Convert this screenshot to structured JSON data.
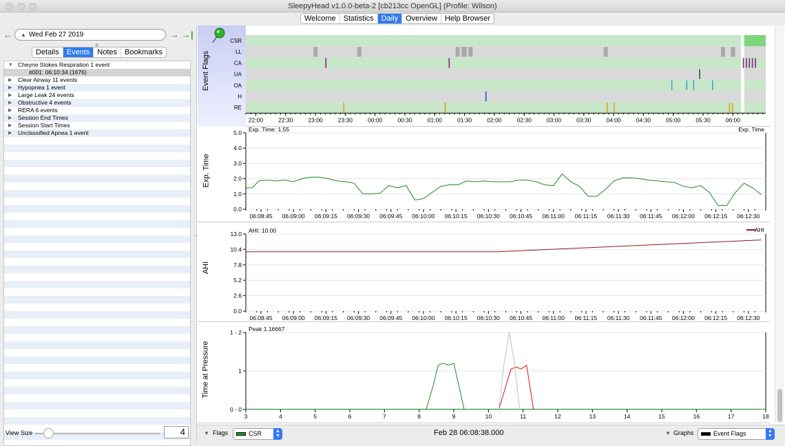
{
  "window": {
    "title": "SleepyHead v1.0.0-beta-2 [cb213cc OpenGL] (Profile: Wilson)"
  },
  "tabs": [
    "Welcome",
    "Statistics",
    "Daily",
    "Overview",
    "Help Browser"
  ],
  "active_tab": "Daily",
  "date_nav": {
    "date": "Wed Feb 27 2019",
    "prev_icon": "arrow-left-icon",
    "next_icon": "arrow-right-icon",
    "last_icon": "arrow-to-end-icon"
  },
  "left_tabs": [
    "Details",
    "Events",
    "Notes",
    "Bookmarks"
  ],
  "active_left_tab": "Events",
  "events": [
    {
      "label": "Cheyne Stokes Respiration 1 event",
      "expanded": true
    },
    {
      "label": "#001: 06:10:34 (1676)",
      "child": true
    },
    {
      "label": "Clear Airway 11 events"
    },
    {
      "label": "Hypopnea 1 event"
    },
    {
      "label": "Large Leak 24 events"
    },
    {
      "label": "Obstructive 4 events"
    },
    {
      "label": "RERA 6 events"
    },
    {
      "label": "Session End Times"
    },
    {
      "label": "Session Start Times"
    },
    {
      "label": "Unclassified Apnea 1 event"
    }
  ],
  "view_size": {
    "label": "View Size",
    "value": "4"
  },
  "colors": {
    "accent": "#2f7bef",
    "green_trace": "#1e8a1e",
    "ahi_trace": "#8b1a1a",
    "red_trace": "#e01010",
    "flag_band": "#c8e6c8"
  },
  "chart_data": [
    {
      "type": "event-flags",
      "ylabel": "Event Flags",
      "rows": [
        "CSR",
        "LL",
        "CA",
        "UA",
        "OA",
        "H",
        "RE"
      ],
      "x_ticks": [
        "22:00",
        "22:30",
        "23:00",
        "23:30",
        "00:00",
        "00:30",
        "01:00",
        "01:30",
        "02:00",
        "02:30",
        "03:00",
        "03:30",
        "04:00",
        "04:30",
        "05:00",
        "05:30",
        "06:00"
      ],
      "flag_colors": {
        "LL": "#a9a9a9",
        "CA": "#8b1a8b",
        "UA": "#1a6b1a",
        "OA": "#4a9ad6",
        "H": "#2a4fd0",
        "RE": "#e0a020"
      },
      "events": {
        "LL": [
          "22:58",
          "23:42",
          "01:21",
          "01:27",
          "01:28",
          "01:34",
          "03:50",
          "05:48",
          "05:58"
        ],
        "CA": [
          "23:10",
          "01:14",
          "06:10",
          "06:13",
          "06:16",
          "06:19",
          "06:22"
        ],
        "UA": [
          "05:26"
        ],
        "OA": [
          "04:58",
          "05:13",
          "05:20",
          "05:39"
        ],
        "H": [
          "01:51"
        ],
        "RE": [
          "23:28",
          "01:10",
          "03:53",
          "04:00",
          "05:56",
          "05:59"
        ]
      }
    },
    {
      "type": "line",
      "ylabel": "Exp. Time",
      "top_left_note": "Exp. Time: 1.55",
      "top_right_note": "Exp. Time",
      "ylim": [
        0,
        5
      ],
      "y_ticks": [
        "5.0",
        "4.0",
        "3.0",
        "2.0",
        "1.0",
        "0.0"
      ],
      "x_ticks": [
        "06:08:45",
        "06:09:00",
        "06:09:15",
        "06:09:30",
        "06:09:45",
        "06:10:00",
        "06:10:15",
        "06:10:30",
        "06:10:45",
        "06:11:00",
        "06:11:15",
        "06:11:30",
        "06:11:45",
        "06:12:00",
        "06:12:15",
        "06:12:30"
      ],
      "series": [
        {
          "t": [
            "06:08:38",
            "06:08:41",
            "06:08:44",
            "06:08:48",
            "06:08:52",
            "06:08:56",
            "06:09:00",
            "06:09:04",
            "06:09:08",
            "06:09:12",
            "06:09:16",
            "06:09:20",
            "06:09:24",
            "06:09:28",
            "06:09:32",
            "06:09:36",
            "06:09:40",
            "06:09:44",
            "06:09:48",
            "06:09:52",
            "06:09:56",
            "06:10:00",
            "06:10:04",
            "06:10:08",
            "06:10:12",
            "06:10:16",
            "06:10:20",
            "06:10:24",
            "06:10:28",
            "06:10:32",
            "06:10:36",
            "06:10:40",
            "06:10:44",
            "06:10:48",
            "06:10:52",
            "06:10:56",
            "06:11:00",
            "06:11:04",
            "06:11:08",
            "06:11:12",
            "06:11:16",
            "06:11:20",
            "06:11:24",
            "06:11:28",
            "06:11:32",
            "06:11:36",
            "06:11:40",
            "06:11:44",
            "06:11:48",
            "06:11:52",
            "06:11:56",
            "06:12:00",
            "06:12:04",
            "06:12:08",
            "06:12:12",
            "06:12:16",
            "06:12:20",
            "06:12:24",
            "06:12:28",
            "06:12:32",
            "06:12:36"
          ],
          "v": [
            1.4,
            1.4,
            1.85,
            1.9,
            1.85,
            1.9,
            1.8,
            2.0,
            2.1,
            2.1,
            2.0,
            1.85,
            1.8,
            1.7,
            1.0,
            1.0,
            1.05,
            1.55,
            1.4,
            1.55,
            0.6,
            0.7,
            1.1,
            1.5,
            1.6,
            1.6,
            1.85,
            1.8,
            1.85,
            1.8,
            1.8,
            1.8,
            1.9,
            1.9,
            1.8,
            1.6,
            1.55,
            2.3,
            1.8,
            1.5,
            0.85,
            0.85,
            1.3,
            1.85,
            2.05,
            2.05,
            2.0,
            1.9,
            1.85,
            1.8,
            1.75,
            1.5,
            1.4,
            1.55,
            1.1,
            0.25,
            0.25,
            1.1,
            1.7,
            1.4,
            0.95
          ]
        }
      ]
    },
    {
      "type": "line",
      "ylabel": "AHI",
      "top_left_note": "AHI: 10.00",
      "legend": "AHI",
      "ylim": [
        0,
        13
      ],
      "y_ticks": [
        "13.0",
        "10.4",
        "7.8",
        "5.2",
        "2.6",
        "0.0"
      ],
      "x_ticks": [
        "06:08:45",
        "06:09:00",
        "06:09:15",
        "06:09:30",
        "06:09:45",
        "06:10:00",
        "06:10:15",
        "06:10:30",
        "06:10:45",
        "06:11:00",
        "06:11:15",
        "06:11:30",
        "06:11:45",
        "06:12:00",
        "06:12:15",
        "06:12:30"
      ],
      "series": [
        {
          "name": "AHI",
          "t": [
            "06:08:38",
            "06:10:34",
            "06:12:36"
          ],
          "v": [
            10.0,
            10.0,
            12.0
          ]
        }
      ]
    },
    {
      "type": "line",
      "ylabel": "Time at Pressure",
      "top_left_note": "Peak 1.16667",
      "ylim": [
        0,
        2
      ],
      "y_ticks": [
        "1 - 2",
        "1",
        "0 - 0"
      ],
      "xlim": [
        3,
        18
      ],
      "x_ticks": [
        "3",
        "4",
        "5",
        "6",
        "7",
        "8",
        "9",
        "10",
        "11",
        "12",
        "13",
        "14",
        "15",
        "16",
        "17",
        "18"
      ],
      "series": [
        {
          "color": "#1e8a1e",
          "x": [
            8.2,
            8.4,
            8.55,
            8.7,
            8.85,
            9.0,
            9.15,
            9.3
          ],
          "v": [
            0,
            0.6,
            1.15,
            1.2,
            1.15,
            1.2,
            0.6,
            0
          ]
        },
        {
          "color": "#e01010",
          "x": [
            10.3,
            10.5,
            10.65,
            10.8,
            10.95,
            11.1,
            11.3
          ],
          "v": [
            0,
            0.6,
            1.05,
            1.1,
            1.05,
            1.15,
            0
          ]
        },
        {
          "color": "#c0c0c0",
          "x": [
            10.3,
            10.45,
            10.6,
            10.75,
            10.9
          ],
          "v": [
            0,
            1.2,
            2.0,
            1.2,
            0
          ]
        }
      ]
    }
  ],
  "bottom": {
    "flags_label": "Flags",
    "flags_combo": "CSR",
    "timestamp": "Feb 28 06:08:38.000",
    "graphs_label": "Graphs",
    "graphs_combo": "Event Flags"
  }
}
